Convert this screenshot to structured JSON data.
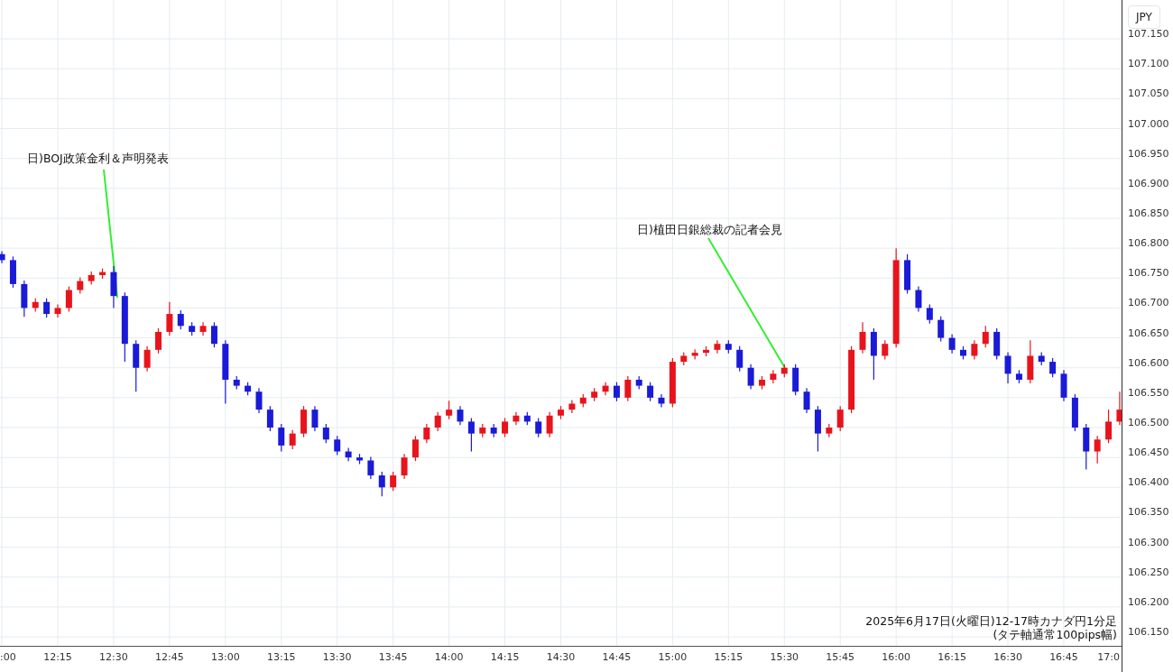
{
  "currency_button": "JPY",
  "annotations": [
    "日)BOJ政策金利＆声明発表",
    "日)植田日銀総裁の記者会見"
  ],
  "cut_time_labels": [
    ":00",
    "17:0"
  ],
  "caption": [
    "2025年6月17日(火曜日)12-17時カナダ円1分足",
    "(タテ軸通常100pips幅)"
  ],
  "chart_data": {
    "type": "candlestick",
    "ylim": [
      106.135,
      107.215
    ],
    "grid": true,
    "yticks": [
      {
        "value": 107.15,
        "label": "107.150"
      },
      {
        "value": 107.1,
        "label": "107.100"
      },
      {
        "value": 107.05,
        "label": "107.050"
      },
      {
        "value": 107.0,
        "label": "107.000"
      },
      {
        "value": 106.95,
        "label": "106.950"
      },
      {
        "value": 106.9,
        "label": "106.900"
      },
      {
        "value": 106.85,
        "label": "106.850"
      },
      {
        "value": 106.8,
        "label": "106.800"
      },
      {
        "value": 106.75,
        "label": "106.750"
      },
      {
        "value": 106.7,
        "label": "106.700"
      },
      {
        "value": 106.65,
        "label": "106.650"
      },
      {
        "value": 106.6,
        "label": "106.600"
      },
      {
        "value": 106.55,
        "label": "106.550"
      },
      {
        "value": 106.5,
        "label": "106.500"
      },
      {
        "value": 106.45,
        "label": "106.450"
      },
      {
        "value": 106.4,
        "label": "106.400"
      },
      {
        "value": 106.35,
        "label": "106.350"
      },
      {
        "value": 106.3,
        "label": "106.300"
      },
      {
        "value": 106.25,
        "label": "106.250"
      },
      {
        "value": 106.2,
        "label": "106.200"
      },
      {
        "value": 106.15,
        "label": "106.150"
      }
    ],
    "categories": [
      null,
      null,
      null,
      null,
      null,
      "12:15",
      null,
      null,
      null,
      null,
      "12:30",
      null,
      null,
      null,
      null,
      "12:45",
      null,
      null,
      null,
      null,
      "13:00",
      null,
      null,
      null,
      null,
      "13:15",
      null,
      null,
      null,
      null,
      "13:30",
      null,
      null,
      null,
      null,
      "13:45",
      null,
      null,
      null,
      null,
      "14:00",
      null,
      null,
      null,
      null,
      "14:15",
      null,
      null,
      null,
      null,
      "14:30",
      null,
      null,
      null,
      null,
      "14:45",
      null,
      null,
      null,
      null,
      "15:00",
      null,
      null,
      null,
      null,
      "15:15",
      null,
      null,
      null,
      null,
      "15:30",
      null,
      null,
      null,
      null,
      "15:45",
      null,
      null,
      null,
      null,
      "16:00",
      null,
      null,
      null,
      null,
      "16:15",
      null,
      null,
      null,
      null,
      "16:30",
      null,
      null,
      null,
      null,
      "16:45",
      null,
      null,
      null,
      null,
      null
    ],
    "ohlc": [
      [
        106.79,
        106.795,
        106.775,
        106.78
      ],
      [
        106.78,
        106.786,
        106.734,
        106.74
      ],
      [
        106.74,
        106.746,
        106.685,
        106.7
      ],
      [
        106.7,
        106.716,
        106.694,
        106.71
      ],
      [
        106.71,
        106.716,
        106.684,
        106.69
      ],
      [
        106.69,
        106.706,
        106.684,
        106.7
      ],
      [
        106.7,
        106.736,
        106.694,
        106.73
      ],
      [
        106.73,
        106.751,
        106.724,
        106.745
      ],
      [
        106.745,
        106.761,
        106.739,
        106.755
      ],
      [
        106.755,
        106.766,
        106.749,
        106.76
      ],
      [
        106.76,
        106.77,
        106.7,
        106.72
      ],
      [
        106.72,
        106.726,
        106.61,
        106.64
      ],
      [
        106.64,
        106.646,
        106.56,
        106.6
      ],
      [
        106.6,
        106.636,
        106.594,
        106.63
      ],
      [
        106.63,
        106.666,
        106.624,
        106.66
      ],
      [
        106.66,
        106.71,
        106.654,
        106.69
      ],
      [
        106.69,
        106.696,
        106.664,
        106.67
      ],
      [
        106.67,
        106.676,
        106.654,
        106.66
      ],
      [
        106.66,
        106.676,
        106.654,
        106.67
      ],
      [
        106.67,
        106.676,
        106.634,
        106.64
      ],
      [
        106.64,
        106.646,
        106.54,
        106.58
      ],
      [
        106.58,
        106.586,
        106.564,
        106.57
      ],
      [
        106.57,
        106.576,
        106.554,
        106.56
      ],
      [
        106.56,
        106.566,
        106.524,
        106.53
      ],
      [
        106.53,
        106.536,
        106.494,
        106.5
      ],
      [
        106.5,
        106.506,
        106.46,
        106.47
      ],
      [
        106.47,
        106.496,
        106.464,
        106.49
      ],
      [
        106.49,
        106.536,
        106.484,
        106.53
      ],
      [
        106.53,
        106.536,
        106.494,
        106.5
      ],
      [
        106.5,
        106.506,
        106.474,
        106.48
      ],
      [
        106.48,
        106.486,
        106.454,
        106.46
      ],
      [
        106.46,
        106.466,
        106.444,
        106.45
      ],
      [
        106.45,
        106.456,
        106.439,
        106.445
      ],
      [
        106.445,
        106.451,
        106.414,
        106.42
      ],
      [
        106.42,
        106.426,
        106.385,
        106.4
      ],
      [
        106.4,
        106.426,
        106.394,
        106.42
      ],
      [
        106.42,
        106.456,
        106.414,
        106.45
      ],
      [
        106.45,
        106.486,
        106.444,
        106.48
      ],
      [
        106.48,
        106.506,
        106.474,
        106.5
      ],
      [
        106.5,
        106.526,
        106.494,
        106.52
      ],
      [
        106.52,
        106.545,
        106.514,
        106.53
      ],
      [
        106.53,
        106.536,
        106.504,
        106.51
      ],
      [
        106.51,
        106.516,
        106.46,
        106.49
      ],
      [
        106.49,
        106.506,
        106.484,
        106.5
      ],
      [
        106.5,
        106.506,
        106.484,
        106.49
      ],
      [
        106.49,
        106.516,
        106.484,
        106.51
      ],
      [
        106.51,
        106.526,
        106.504,
        106.52
      ],
      [
        106.52,
        106.526,
        106.504,
        106.51
      ],
      [
        106.51,
        106.516,
        106.484,
        106.49
      ],
      [
        106.49,
        106.526,
        106.484,
        106.52
      ],
      [
        106.52,
        106.536,
        106.514,
        106.53
      ],
      [
        106.53,
        106.546,
        106.524,
        106.54
      ],
      [
        106.54,
        106.556,
        106.534,
        106.55
      ],
      [
        106.55,
        106.566,
        106.544,
        106.56
      ],
      [
        106.56,
        106.576,
        106.554,
        106.57
      ],
      [
        106.57,
        106.576,
        106.544,
        106.55
      ],
      [
        106.55,
        106.586,
        106.544,
        106.58
      ],
      [
        106.58,
        106.586,
        106.564,
        106.57
      ],
      [
        106.57,
        106.576,
        106.544,
        106.55
      ],
      [
        106.55,
        106.556,
        106.534,
        106.54
      ],
      [
        106.54,
        106.616,
        106.534,
        106.61
      ],
      [
        106.61,
        106.626,
        106.604,
        106.62
      ],
      [
        106.62,
        106.631,
        106.614,
        106.625
      ],
      [
        106.625,
        106.636,
        106.619,
        106.63
      ],
      [
        106.63,
        106.646,
        106.624,
        106.64
      ],
      [
        106.64,
        106.646,
        106.624,
        106.63
      ],
      [
        106.63,
        106.636,
        106.594,
        106.6
      ],
      [
        106.6,
        106.606,
        106.564,
        106.57
      ],
      [
        106.57,
        106.586,
        106.564,
        106.58
      ],
      [
        106.58,
        106.596,
        106.574,
        106.59
      ],
      [
        106.59,
        106.606,
        106.584,
        106.6
      ],
      [
        106.6,
        106.606,
        106.554,
        106.56
      ],
      [
        106.56,
        106.566,
        106.524,
        106.53
      ],
      [
        106.53,
        106.536,
        106.46,
        106.49
      ],
      [
        106.49,
        106.506,
        106.484,
        106.5
      ],
      [
        106.5,
        106.536,
        106.494,
        106.53
      ],
      [
        106.53,
        106.636,
        106.524,
        106.63
      ],
      [
        106.63,
        106.676,
        106.624,
        106.66
      ],
      [
        106.66,
        106.666,
        106.58,
        106.62
      ],
      [
        106.62,
        106.646,
        106.614,
        106.64
      ],
      [
        106.64,
        106.8,
        106.634,
        106.78
      ],
      [
        106.78,
        106.79,
        106.724,
        106.73
      ],
      [
        106.73,
        106.736,
        106.694,
        106.7
      ],
      [
        106.7,
        106.706,
        106.674,
        106.68
      ],
      [
        106.68,
        106.686,
        106.644,
        106.65
      ],
      [
        106.65,
        106.656,
        106.624,
        106.63
      ],
      [
        106.63,
        106.636,
        106.614,
        106.62
      ],
      [
        106.62,
        106.646,
        106.614,
        106.64
      ],
      [
        106.64,
        106.67,
        106.634,
        106.66
      ],
      [
        106.66,
        106.666,
        106.614,
        106.62
      ],
      [
        106.62,
        106.626,
        106.574,
        106.59
      ],
      [
        106.59,
        106.596,
        106.574,
        106.58
      ],
      [
        106.58,
        106.646,
        106.574,
        106.62
      ],
      [
        106.62,
        106.626,
        106.604,
        106.61
      ],
      [
        106.61,
        106.616,
        106.584,
        106.59
      ],
      [
        106.59,
        106.596,
        106.544,
        106.55
      ],
      [
        106.55,
        106.556,
        106.494,
        106.5
      ],
      [
        106.5,
        106.506,
        106.43,
        106.46
      ],
      [
        106.46,
        106.486,
        106.44,
        106.48
      ],
      [
        106.48,
        106.53,
        106.474,
        106.51
      ],
      [
        106.51,
        106.56,
        106.504,
        106.53
      ]
    ]
  }
}
